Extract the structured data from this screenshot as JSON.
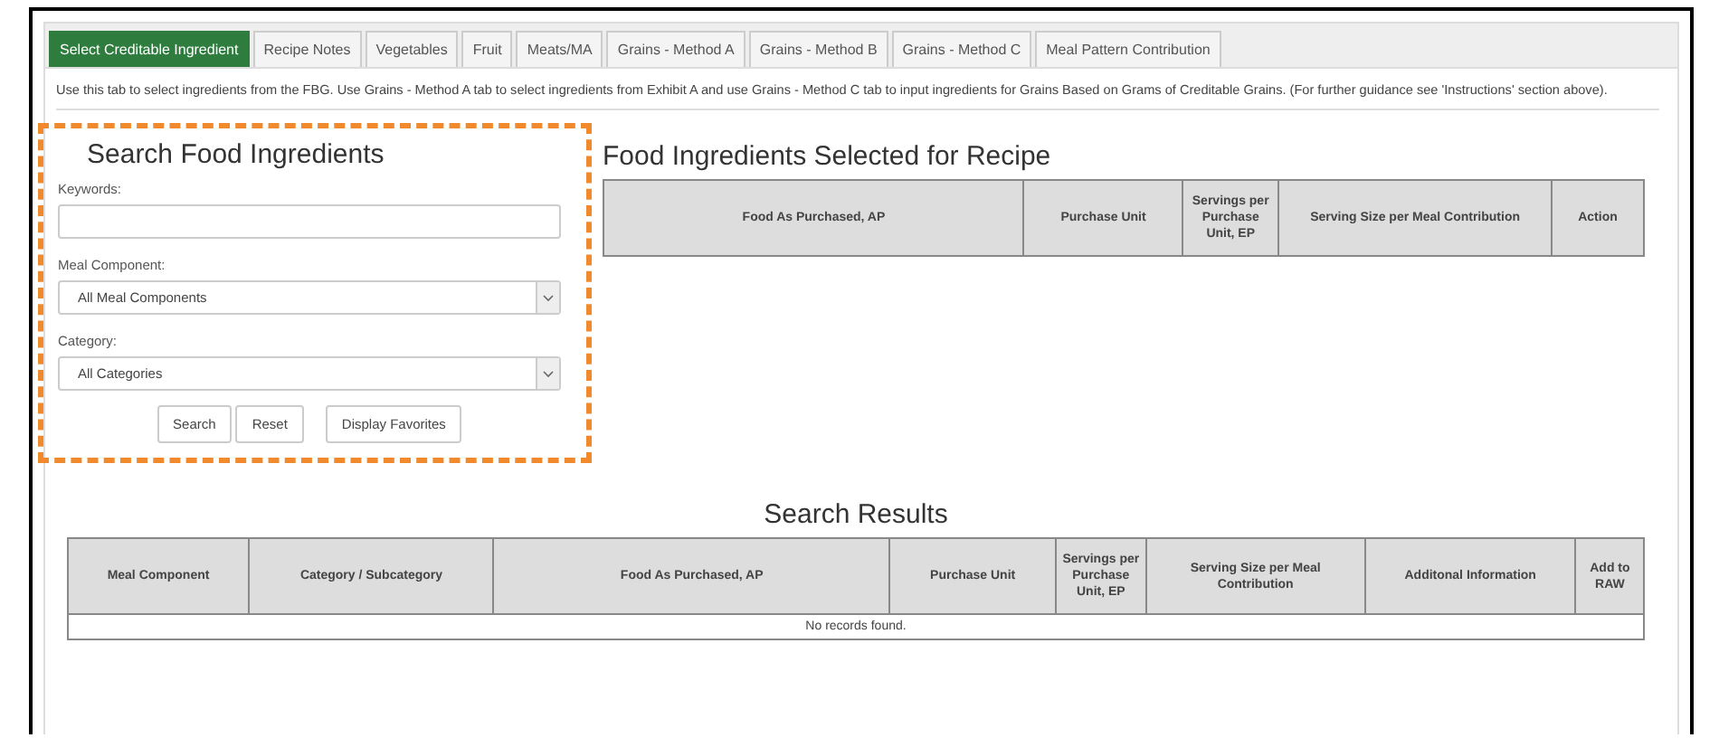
{
  "tabs": [
    {
      "label": "Select Creditable Ingredient",
      "selected": true
    },
    {
      "label": "Recipe Notes",
      "selected": false
    },
    {
      "label": "Vegetables",
      "selected": false
    },
    {
      "label": "Fruit",
      "selected": false
    },
    {
      "label": "Meats/MA",
      "selected": false
    },
    {
      "label": "Grains - Method A",
      "selected": false
    },
    {
      "label": "Grains - Method B",
      "selected": false
    },
    {
      "label": "Grains - Method C",
      "selected": false
    },
    {
      "label": "Meal Pattern Contribution",
      "selected": false
    }
  ],
  "instructions": "Use this tab to select ingredients from the FBG. Use Grains - Method A tab to select ingredients from Exhibit A and use Grains - Method C tab to input ingredients for Grains Based on Grams of Creditable Grains. (For further guidance see 'Instructions' section above).",
  "search_panel": {
    "title": "Search Food Ingredients",
    "highlighted": true,
    "fields": [
      {
        "kind": "text",
        "label": "Keywords:"
      },
      {
        "kind": "select",
        "label": "Meal Component:",
        "value": "All Meal Components"
      },
      {
        "kind": "select",
        "label": "Category:",
        "value": "All Categories"
      }
    ],
    "buttons": [
      "Search",
      "Reset",
      "Display Favorites"
    ]
  },
  "selected_table": {
    "title": "Food Ingredients Selected for Recipe",
    "columns": [
      "Food As Purchased, AP",
      "Purchase Unit",
      "Servings per Purchase Unit, EP",
      "Serving Size per Meal Contribution",
      "Action"
    ]
  },
  "results_table": {
    "title": "Search Results",
    "columns": [
      "Meal Component",
      "Category / Subcategory",
      "Food As Purchased, AP",
      "Purchase Unit",
      "Servings per Purchase Unit, EP",
      "Serving Size per Meal Contribution",
      "Additonal Information",
      "Add to RAW"
    ],
    "empty_message": "No records found."
  }
}
